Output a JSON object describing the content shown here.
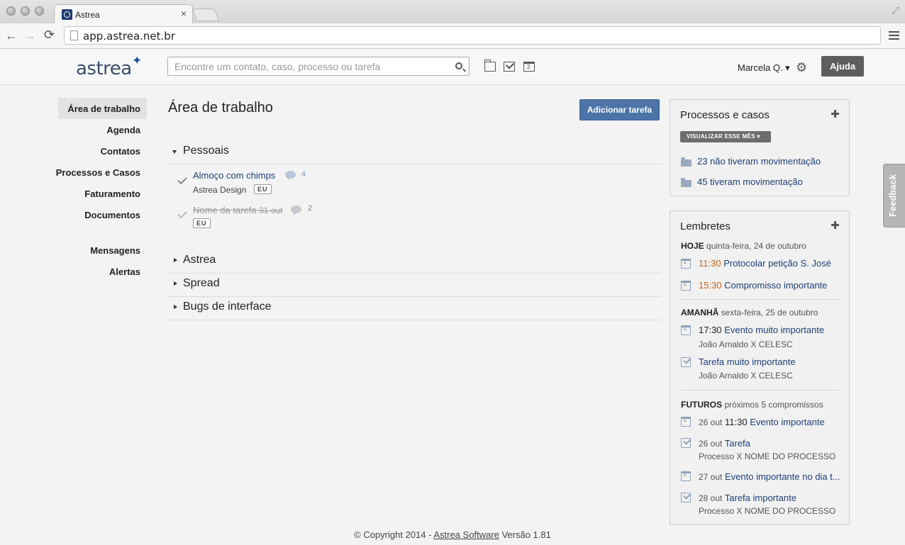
{
  "browser": {
    "tab_title": "Astrea",
    "tab_close": "×",
    "url": "app.astrea.net.br",
    "back": "←",
    "forward": "→",
    "reload": "⟳",
    "expand": "⤢"
  },
  "header": {
    "logo": "astrea",
    "search_placeholder": "Encontre um contato, caso, processo ou tarefa",
    "user": "Marcela Q. ▾",
    "help_label": "Ajuda"
  },
  "sidebar": {
    "items": [
      {
        "label": "Área de trabalho",
        "active": true
      },
      {
        "label": "Agenda"
      },
      {
        "label": "Contatos"
      },
      {
        "label": "Processos e Casos"
      },
      {
        "label": "Faturamento"
      },
      {
        "label": "Documentos"
      },
      {
        "label": "Mensagens"
      },
      {
        "label": "Alertas"
      }
    ]
  },
  "main": {
    "title": "Área de trabalho",
    "add_task_label": "Adicionar tarefa",
    "groups": [
      {
        "title": "Pessoais",
        "expanded": true
      },
      {
        "title": "Astrea",
        "expanded": false
      },
      {
        "title": "Spread",
        "expanded": false
      },
      {
        "title": "Bugs de interface",
        "expanded": false
      }
    ],
    "tasks": [
      {
        "title": "Almoço com chimps",
        "comments": "4",
        "sub": "Astrea Design",
        "badge": "EU",
        "done": false
      },
      {
        "title": "Nome da tarefa",
        "date": "31 out",
        "comments": "2",
        "badge": "EU",
        "done": true
      }
    ]
  },
  "processes": {
    "title": "Processos e casos",
    "dropdown": "VISUALIZAR ESSE MÊS ▾",
    "links": [
      "23 não tiveram movimentação",
      "45 tiveram movimentação"
    ]
  },
  "reminders": {
    "title": "Lembretes",
    "today": {
      "label": "HOJE",
      "date": "quinta-feira, 24 de outubro"
    },
    "today_items": [
      {
        "time": "11:30",
        "text": "Protocolar petição S. José"
      },
      {
        "time": "15:30",
        "text": "Compromisso importante"
      }
    ],
    "tomorrow": {
      "label": "AMANHÃ",
      "date": "sexta-feira, 25 de outubro"
    },
    "tomorrow_items": [
      {
        "time": "17:30",
        "text": "Evento muito importante",
        "sub": "João Arnaldo X CELESC"
      },
      {
        "time": "",
        "text": "Tarefa muito importante",
        "sub": "João Arnaldo X CELESC"
      }
    ],
    "future": {
      "label": "FUTUROS",
      "desc": "próximos 5 compromissos"
    },
    "future_items": [
      {
        "date": "26 out",
        "time": "11:30",
        "text": "Evento importante"
      },
      {
        "date": "26 out",
        "time": "",
        "text": "Tarefa",
        "sub": "Processo X NOME DO PROCESSO"
      },
      {
        "date": "27 out",
        "time": "",
        "text": "Evento importante no dia t..."
      },
      {
        "date": "28 out",
        "time": "",
        "text": "Tarefa importante",
        "sub": "Processo X NOME DO PROCESSO"
      }
    ]
  },
  "feedback_label": "Feedback",
  "footer": {
    "prefix": "© Copyright 2014 - ",
    "link": "Astrea Software",
    "suffix": " Versão 1.81"
  },
  "colors": {
    "accent_blue": "#4d74a8",
    "link_blue": "#1e3f75",
    "time_orange": "#c7651a"
  }
}
